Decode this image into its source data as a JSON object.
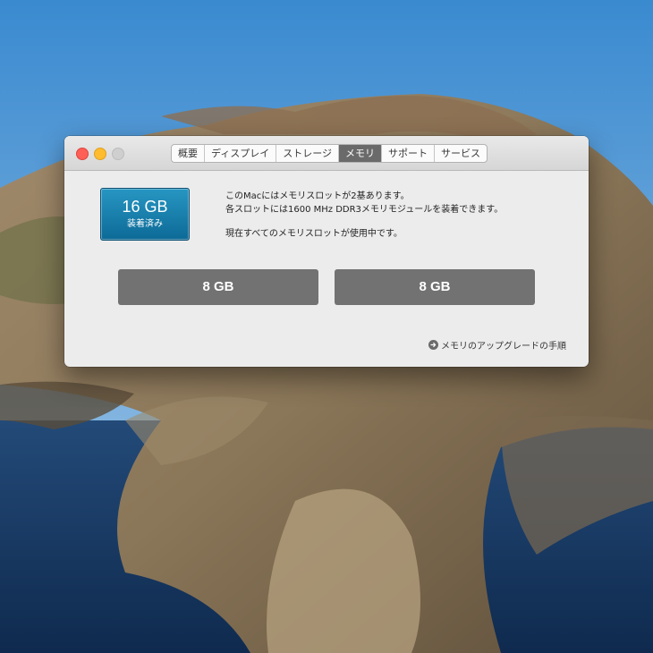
{
  "tabs": [
    {
      "label": "概要"
    },
    {
      "label": "ディスプレイ"
    },
    {
      "label": "ストレージ"
    },
    {
      "label": "メモリ",
      "active": true
    },
    {
      "label": "サポート"
    },
    {
      "label": "サービス"
    }
  ],
  "memory": {
    "total": "16 GB",
    "total_label": "装着済み",
    "info_line1": "このMacにはメモリスロットが2基あります。",
    "info_line2": "各スロットには1600 MHz DDR3メモリモジュールを装着できます。",
    "info_line3": "現在すべてのメモリスロットが使用中です。",
    "slots": [
      {
        "size": "8 GB"
      },
      {
        "size": "8 GB"
      }
    ],
    "upgrade_link": "メモリのアップグレードの手順"
  },
  "icons": {
    "close": "close-button",
    "minimize": "minimize-button",
    "zoom": "zoom-button",
    "upgrade": "arrow-circle-right-icon"
  },
  "colors": {
    "close": "#fe5f57",
    "minimize": "#febc2e",
    "zoom": "#cfcfcf",
    "total_badge": "#1b82b0",
    "slot": "#727272",
    "active_tab": "#6a6a6a"
  }
}
